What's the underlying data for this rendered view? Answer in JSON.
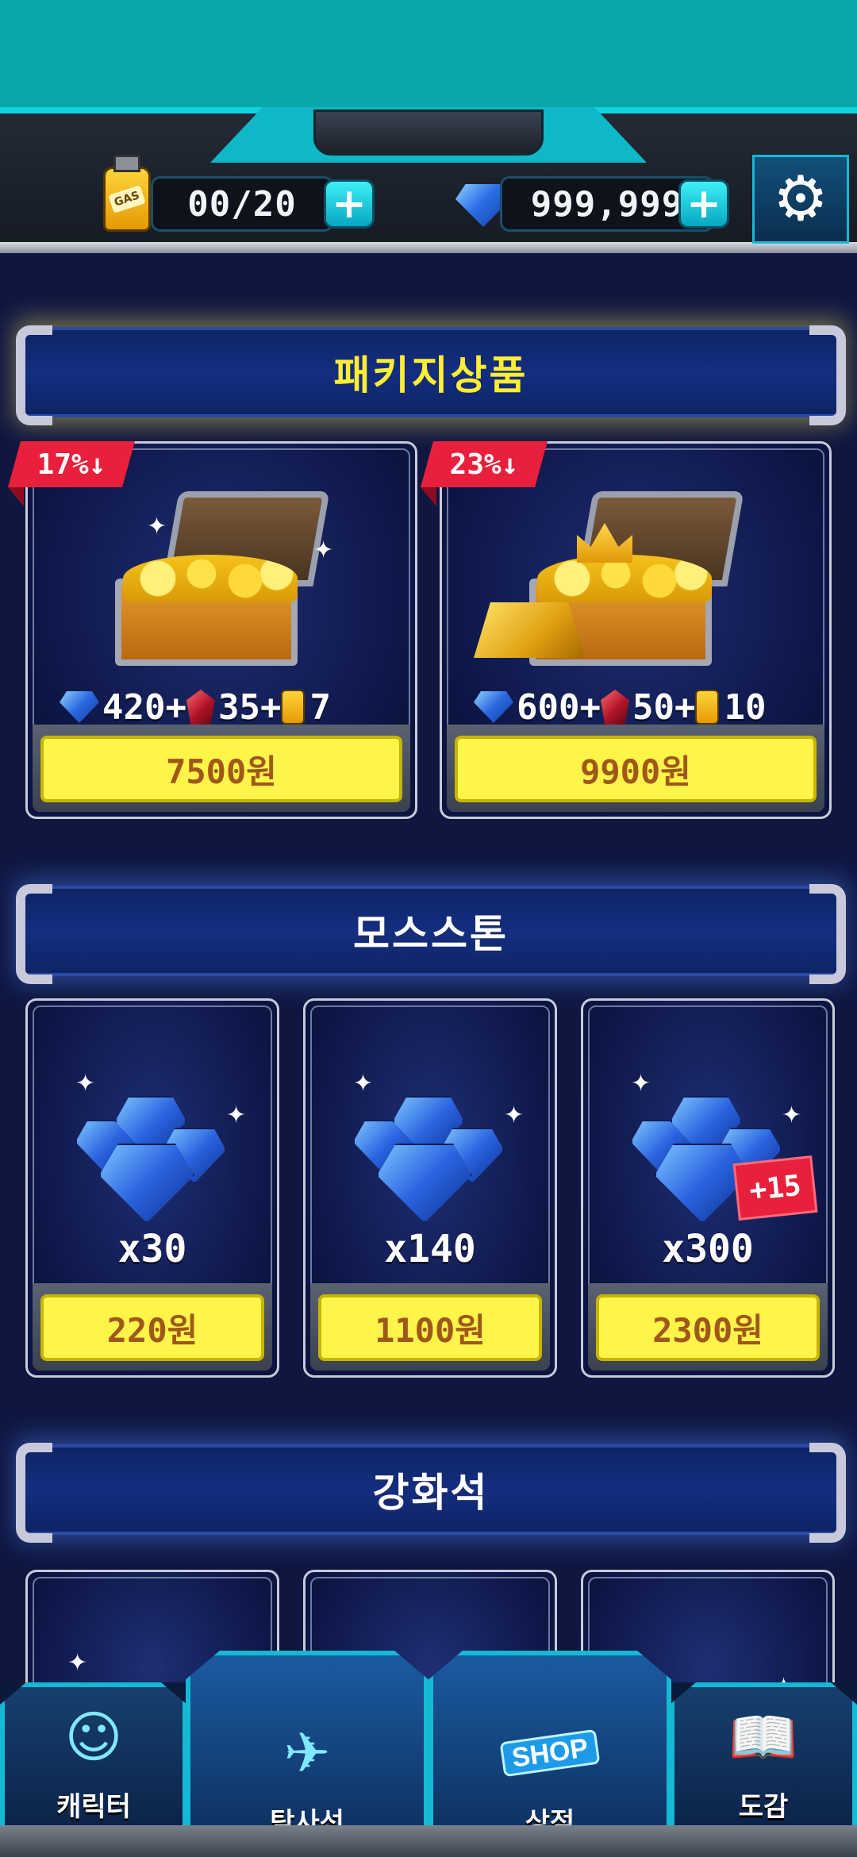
{
  "status_bar": {
    "gas_label": "GAS",
    "gas_count": "00/20",
    "gem_count": "999,999",
    "plus_symbol": "+",
    "settings_icon": "gear-icon"
  },
  "sections": {
    "package": {
      "title": "패키지상품",
      "items": [
        {
          "discount": "17%↓",
          "gems": "420+",
          "rubies": "35+",
          "gas": "7",
          "price": "7500원"
        },
        {
          "discount": "23%↓",
          "gems": "600+",
          "rubies": "50+",
          "gas": "10",
          "price": "9900원"
        }
      ]
    },
    "mosstone": {
      "title": "모스스톤",
      "items": [
        {
          "qty": "x30",
          "price": "220원"
        },
        {
          "qty": "x140",
          "price": "1100원"
        },
        {
          "qty": "x300",
          "bonus": "+15",
          "price": "2300원"
        }
      ]
    },
    "reinforce": {
      "title": "강화석"
    }
  },
  "nav": {
    "items": [
      {
        "label": "캐릭터",
        "icon": "character-icon"
      },
      {
        "label": "탐사선",
        "icon": "spaceship-icon"
      },
      {
        "label": "상점",
        "icon": "shop-cart-icon",
        "tag": "SHOP"
      },
      {
        "label": "도감",
        "icon": "book-icon"
      }
    ]
  },
  "colors": {
    "accent_cyan": "#0fd3e0",
    "price_yellow": "#fff44a",
    "discount_red": "#e8203c",
    "background_navy": "#0f1640"
  }
}
